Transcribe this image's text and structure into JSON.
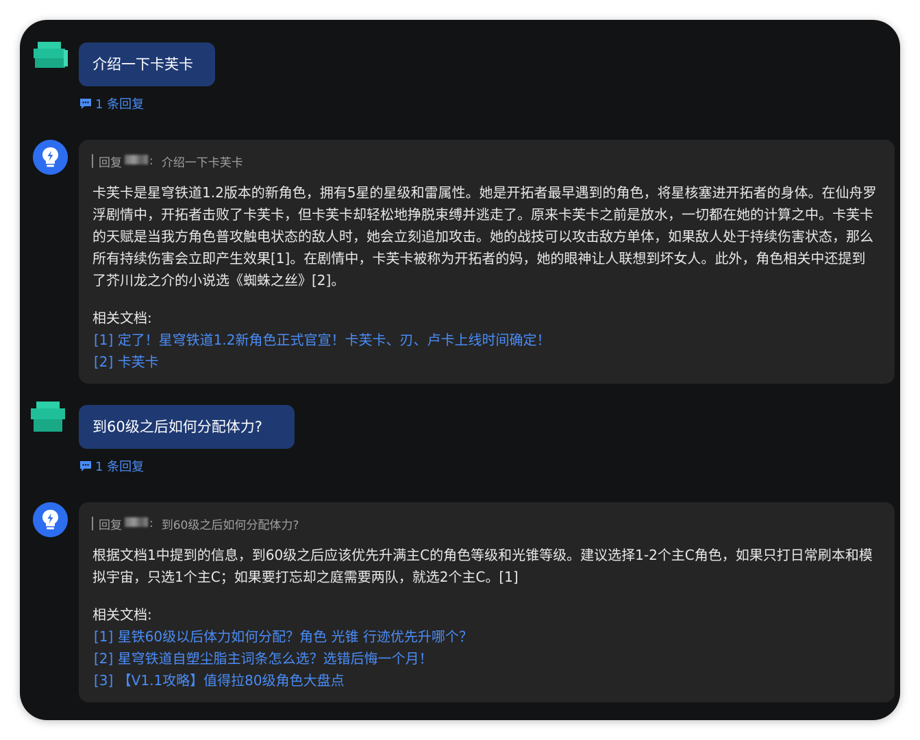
{
  "conversation": [
    {
      "user": {
        "message": "介绍一下卡芙卡",
        "reply_count_label": "1 条回复"
      },
      "bot": {
        "quote_prefix": "回复",
        "quote_sep": ":",
        "quote_text": "介绍一下卡芙卡",
        "answer": "卡芙卡是星穹铁道1.2版本的新角色，拥有5星的星级和雷属性。她是开拓者最早遇到的角色，将星核塞进开拓者的身体。在仙舟罗浮剧情中，开拓者击败了卡芙卡，但卡芙卡却轻松地挣脱束缚并逃走了。原来卡芙卡之前是放水，一切都在她的计算之中。卡芙卡的天赋是当我方角色普攻触电状态的敌人时，她会立刻追加攻击。她的战技可以攻击敌方单体，如果敌人处于持续伤害状态，那么所有持续伤害会立即产生效果[1]。在剧情中，卡芙卡被称为开拓者的妈，她的眼神让人联想到坏女人。此外，角色相关中还提到了芥川龙之介的小说选《蜘蛛之丝》[2]。",
        "docs_title": "相关文档:",
        "docs": [
          "[1] 定了！星穹铁道1.2新角色正式官宣！卡芙卡、刃、卢卡上线时间确定！",
          "[2] 卡芙卡"
        ]
      }
    },
    {
      "user": {
        "message": "到60级之后如何分配体力?",
        "reply_count_label": "1 条回复"
      },
      "bot": {
        "quote_prefix": "回复",
        "quote_sep": ":",
        "quote_text": "到60级之后如何分配体力?",
        "answer": "根据文档1中提到的信息，到60级之后应该优先升满主C的角色等级和光锥等级。建议选择1-2个主C角色，如果只打日常刷本和模拟宇宙，只选1个主C；如果要打忘却之庭需要两队，就选2个主C。[1]",
        "docs_title": "相关文档:",
        "docs": [
          "[1] 星铁60级以后体力如何分配？角色 光锥 行迹优先升哪个？",
          "[2] 星穹铁道自塑尘脂主词条怎么选？选错后悔一个月！",
          "[3] 【V1.1攻略】值得拉80级角色大盘点"
        ]
      }
    }
  ],
  "colors": {
    "background": "#121314",
    "user_bubble": "#1f3a73",
    "bot_card": "#252525",
    "link": "#4a8cf7",
    "bot_avatar": "#2d6ef0",
    "user_avatar": "#1fbf9a"
  },
  "icons": {
    "user_avatar": "pixelated-user-avatar-icon",
    "bot_avatar": "lightbulb-lightning-icon",
    "reply": "chat-bubble-icon"
  }
}
